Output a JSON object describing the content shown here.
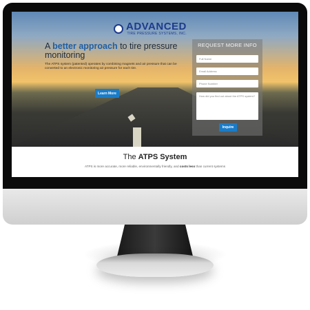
{
  "logo": {
    "name": "ADVANCED",
    "tagline": "TIRE PRESSURE SYSTEMS, INC."
  },
  "hero": {
    "headline_prefix": "A ",
    "headline_accent": "better approach",
    "headline_suffix": " to tire pressure monitoring",
    "blurb": "The ATPS system (patented) operates by combining magnets and air pressure that can be converted to an electronic monitoring air pressure for each tire.",
    "learn_more_label": "Learn More"
  },
  "form": {
    "title": "REQUEST MORE INFO",
    "full_name_placeholder": "Full Name",
    "email_placeholder": "Email Address",
    "phone_placeholder": "Phone Number",
    "question_placeholder": "How did you find out about the ATPS system?",
    "submit_label": "Inquire"
  },
  "section": {
    "title_prefix": "The ",
    "title_bold": "ATPS System",
    "text_prefix": "ATPS is more accurate, more reliable, environmentally friendly, and ",
    "text_bold": "costs less",
    "text_suffix": " than current systems"
  },
  "colors": {
    "accent": "#1d5fa8",
    "button": "#1a7cc8",
    "logo": "#1d3b8c"
  },
  "icons": {
    "logo_mark": "tire-gauge-icon"
  }
}
